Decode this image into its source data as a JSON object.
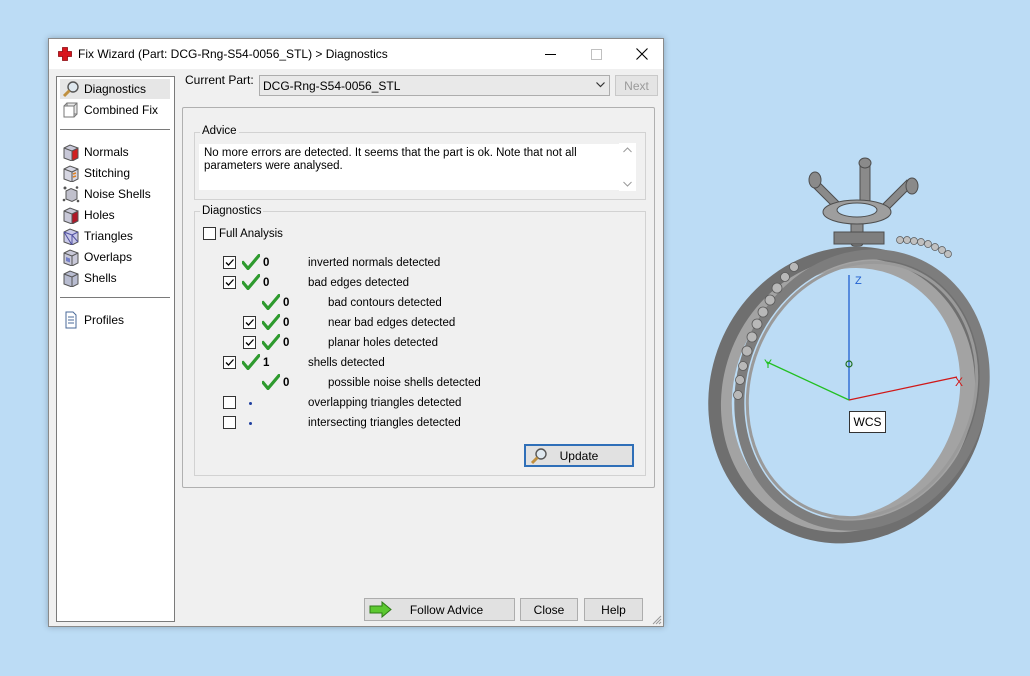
{
  "window": {
    "title": "Fix Wizard (Part: DCG-Rng-S54-0056_STL) > Diagnostics"
  },
  "nav": {
    "items": [
      {
        "label": "Diagnostics",
        "icon": "magnifier-icon",
        "selected": true
      },
      {
        "label": "Combined Fix",
        "icon": "combined-fix-icon",
        "selected": false
      },
      {
        "label": "Normals",
        "icon": "normals-cube-icon",
        "selected": false
      },
      {
        "label": "Stitching",
        "icon": "stitching-cube-icon",
        "selected": false
      },
      {
        "label": "Noise Shells",
        "icon": "noise-shells-icon",
        "selected": false
      },
      {
        "label": "Holes",
        "icon": "holes-cube-icon",
        "selected": false
      },
      {
        "label": "Triangles",
        "icon": "triangles-cube-icon",
        "selected": false
      },
      {
        "label": "Overlaps",
        "icon": "overlaps-cube-icon",
        "selected": false
      },
      {
        "label": "Shells",
        "icon": "shells-cube-icon",
        "selected": false
      },
      {
        "label": "Profiles",
        "icon": "profile-document-icon",
        "selected": false
      }
    ]
  },
  "part": {
    "label": "Current Part:",
    "value": "DCG-Rng-S54-0056_STL",
    "next_label": "Next"
  },
  "advice": {
    "legend": "Advice",
    "text": "No more errors are detected. It seems that the part is ok. Note that not all parameters were analysed."
  },
  "diagnostics": {
    "legend": "Diagnostics",
    "full_analysis_label": "Full Analysis",
    "full_analysis_checked": false,
    "rows": [
      {
        "checkbox": true,
        "checked": true,
        "status": "ok",
        "count": "0",
        "label": "inverted normals detected",
        "indent": false
      },
      {
        "checkbox": true,
        "checked": true,
        "status": "ok",
        "count": "0",
        "label": "bad edges detected",
        "indent": false
      },
      {
        "checkbox": false,
        "checked": false,
        "status": "ok",
        "count": "0",
        "label": "bad contours detected",
        "indent": true
      },
      {
        "checkbox": true,
        "checked": true,
        "status": "ok",
        "count": "0",
        "label": "near bad edges detected",
        "indent": true
      },
      {
        "checkbox": true,
        "checked": true,
        "status": "ok",
        "count": "0",
        "label": "planar holes detected",
        "indent": true
      },
      {
        "checkbox": true,
        "checked": true,
        "status": "ok",
        "count": "1",
        "label": "shells detected",
        "indent": false
      },
      {
        "checkbox": false,
        "checked": false,
        "status": "ok",
        "count": "0",
        "label": "possible noise shells detected",
        "indent": true
      },
      {
        "checkbox": true,
        "checked": false,
        "status": "pending",
        "count": "",
        "label": "overlapping triangles detected",
        "indent": false
      },
      {
        "checkbox": true,
        "checked": false,
        "status": "pending",
        "count": "",
        "label": "intersecting triangles detected",
        "indent": false
      }
    ],
    "update_label": "Update"
  },
  "footer": {
    "follow_advice_label": "Follow Advice",
    "close_label": "Close",
    "help_label": "Help"
  },
  "viewport": {
    "wcs_label": "WCS",
    "axis_labels": {
      "x": "X",
      "y": "Y",
      "z": "Z"
    },
    "colors": {
      "x": "#d01818",
      "y": "#22c022",
      "z": "#2060d0",
      "background": "#bcdcf5",
      "model": "#7a7a7a"
    }
  }
}
